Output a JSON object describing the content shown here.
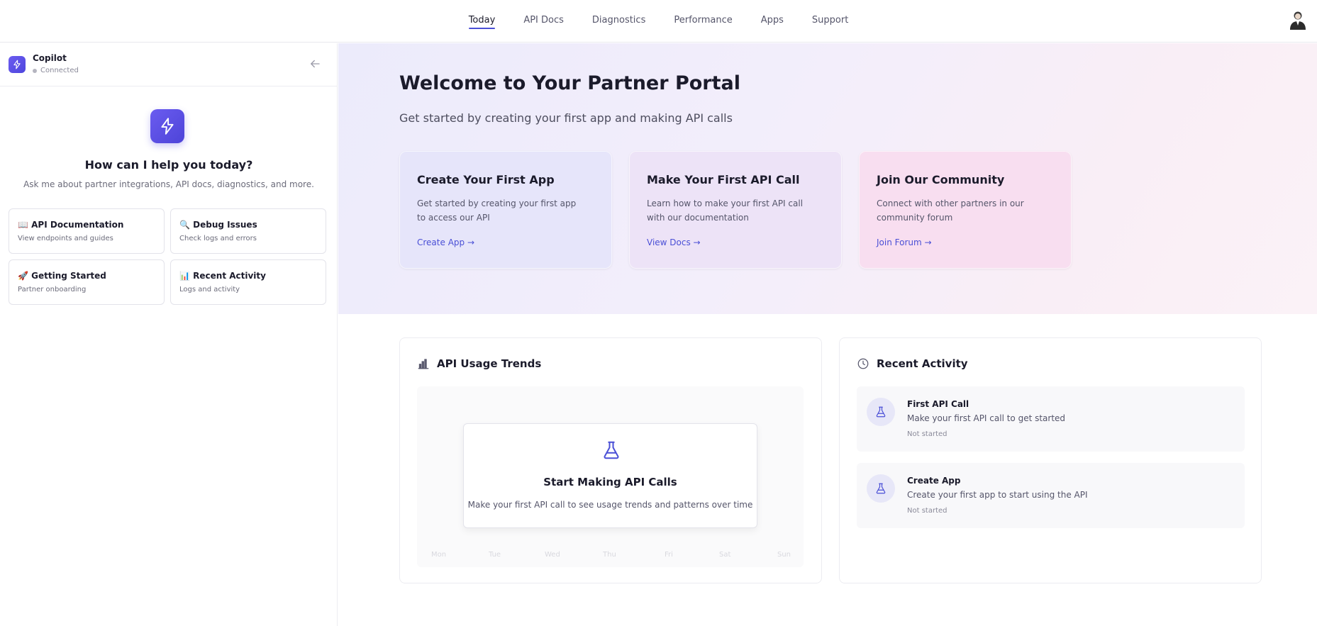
{
  "nav": {
    "tabs": [
      {
        "label": "Today",
        "active": true
      },
      {
        "label": "API Docs"
      },
      {
        "label": "Diagnostics"
      },
      {
        "label": "Performance"
      },
      {
        "label": "Apps"
      },
      {
        "label": "Support"
      }
    ]
  },
  "sidebar": {
    "title": "Copilot",
    "status": "Connected",
    "question": "How can I help you today?",
    "subtitle": "Ask me about partner integrations, API docs, diagnostics, and more.",
    "actions": [
      {
        "icon": "📖",
        "title": "API Documentation",
        "desc": "View endpoints and guides"
      },
      {
        "icon": "🔍",
        "title": "Debug Issues",
        "desc": "Check logs and errors"
      },
      {
        "icon": "🚀",
        "title": "Getting Started",
        "desc": "Partner onboarding"
      },
      {
        "icon": "📊",
        "title": "Recent Activity",
        "desc": "Logs and activity"
      }
    ]
  },
  "hero": {
    "title": "Welcome to Your Partner Portal",
    "subtitle": "Get started by creating your first app and making API calls",
    "cards": [
      {
        "title": "Create Your First App",
        "desc": "Get started by creating your first app to access our API",
        "link": "Create App →",
        "bg": "#e6e5fa"
      },
      {
        "title": "Make Your First API Call",
        "desc": "Learn how to make your first API call with our documentation",
        "link": "View Docs →",
        "bg": "#ede3f7"
      },
      {
        "title": "Join Our Community",
        "desc": "Connect with other partners in our community forum",
        "link": "Join Forum →",
        "bg": "#f8def0"
      }
    ]
  },
  "usage": {
    "title": "API Usage Trends",
    "days": [
      "Mon",
      "Tue",
      "Wed",
      "Thu",
      "Fri",
      "Sat",
      "Sun"
    ],
    "empty_title": "Start Making API Calls",
    "empty_desc": "Make your first API call to see usage trends and patterns over time"
  },
  "activity": {
    "title": "Recent Activity",
    "items": [
      {
        "title": "First API Call",
        "desc": "Make your first API call to get started",
        "status": "Not started"
      },
      {
        "title": "Create App",
        "desc": "Create your first app to start using the API",
        "status": "Not started"
      }
    ]
  },
  "colors": {
    "accent": "#4a4fd6",
    "brand": "#5b50e6"
  }
}
